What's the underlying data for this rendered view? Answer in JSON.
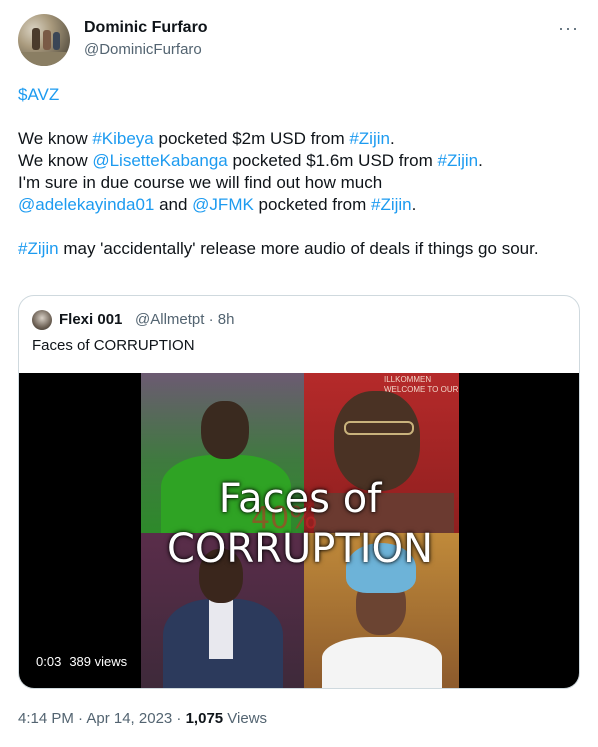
{
  "author": {
    "name": "Dominic Furfaro",
    "handle": "@DominicFurfaro"
  },
  "tweet": {
    "cashtag": "$AVZ",
    "line1": {
      "pre": "We know ",
      "tag1": "#Kibeya",
      "mid": " pocketed $2m USD from ",
      "tag2": "#Zijin",
      "post": "."
    },
    "line2": {
      "pre": "We know ",
      "mention": "@LisetteKabanga",
      "mid": " pocketed $1.6m USD from ",
      "tag": "#Zijin",
      "post": "."
    },
    "line3": "I'm sure in due course we will find out how much",
    "line4": {
      "mention1": "@adelekayinda01",
      "mid": " and ",
      "mention2": "@JFMK",
      "mid2": " pocketed from ",
      "tag": "#Zijin",
      "post": "."
    },
    "line5": {
      "tag": "#Zijin",
      "rest": " may 'accidentally' release more audio of deals if things go sour."
    }
  },
  "quote": {
    "name": "Flexi 001",
    "meta": "@Allmetpt · 8h",
    "text": "Faces of CORRUPTION",
    "video": {
      "overlay_line1": "Faces of",
      "overlay_line2": "CORRUPTION",
      "background_percent": "40%",
      "sign_text": "ILLKOMMEN\nWELCOME TO OUR",
      "time": "0:03",
      "views": "389 views"
    }
  },
  "footer": {
    "timestamp": "4:14 PM · Apr 14, 2023 · ",
    "views_count": "1,075",
    "views_label": " Views"
  },
  "icons": {
    "more": "more-horizontal-icon"
  },
  "colors": {
    "link": "#1d9bf0",
    "secondary_text": "#536471",
    "primary_text": "#0f1419",
    "border": "#cfd9de"
  }
}
